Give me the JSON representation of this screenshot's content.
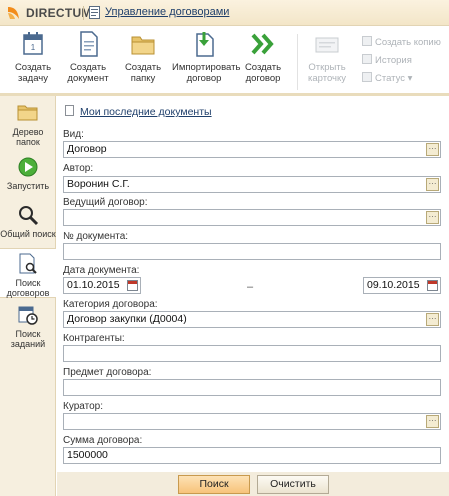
{
  "titlebar": {
    "brand": "DIRECTUM",
    "app_title": "Управление договорами"
  },
  "ribbon": {
    "buttons": [
      {
        "label": "Создать\nзадачу",
        "icon": "calendar-icon"
      },
      {
        "label": "Создать\nдокумент",
        "icon": "document-icon"
      },
      {
        "label": "Создать\nпапку",
        "icon": "folder-icon"
      },
      {
        "label": "Импортировать\nдоговор",
        "icon": "import-icon"
      },
      {
        "label": "Создать\nдоговор",
        "icon": "double-chevron-icon"
      },
      {
        "label": "Открыть\nкарточку",
        "icon": "card-icon",
        "disabled": true
      }
    ],
    "small": [
      {
        "label": "Создать копию",
        "icon": "copy-icon"
      },
      {
        "label": "История",
        "icon": "history-icon"
      },
      {
        "label": "Статус ▾",
        "icon": "status-icon"
      }
    ]
  },
  "nav": [
    {
      "label": "Дерево\nпапок",
      "icon": "folders-icon"
    },
    {
      "label": "Запустить",
      "icon": "play-icon"
    },
    {
      "label": "Общий поиск",
      "icon": "magnifier-icon"
    },
    {
      "label": "Поиск\nдоговоров",
      "icon": "contract-search-icon",
      "active": true
    },
    {
      "label": "Поиск\nзаданий",
      "icon": "task-search-icon"
    }
  ],
  "main": {
    "recent_link": "Мои последние документы",
    "fields": {
      "vid": {
        "label": "Вид:",
        "value": "Договор"
      },
      "author": {
        "label": "Автор:",
        "value": "Воронин С.Г."
      },
      "lead": {
        "label": "Ведущий договор:",
        "value": ""
      },
      "docnum": {
        "label": "№ документа:",
        "value": ""
      },
      "date": {
        "label": "Дата документа:",
        "from": "01.10.2015",
        "to": "09.10.2015",
        "dash": "–"
      },
      "category": {
        "label": "Категория договора:",
        "value": "Договор закупки (Д0004)"
      },
      "counterparties": {
        "label": "Контрагенты:",
        "value": ""
      },
      "subject": {
        "label": "Предмет договора:",
        "value": ""
      },
      "curator": {
        "label": "Куратор:",
        "value": ""
      },
      "sum": {
        "label": "Сумма договора:",
        "value": "1500000"
      }
    },
    "search_button": "Поиск",
    "clear_button": "Очистить",
    "picker_glyph": "···"
  },
  "colors": {
    "accent": "#f7c37a",
    "link": "#1f3f6b",
    "panel": "#f6efdf"
  }
}
